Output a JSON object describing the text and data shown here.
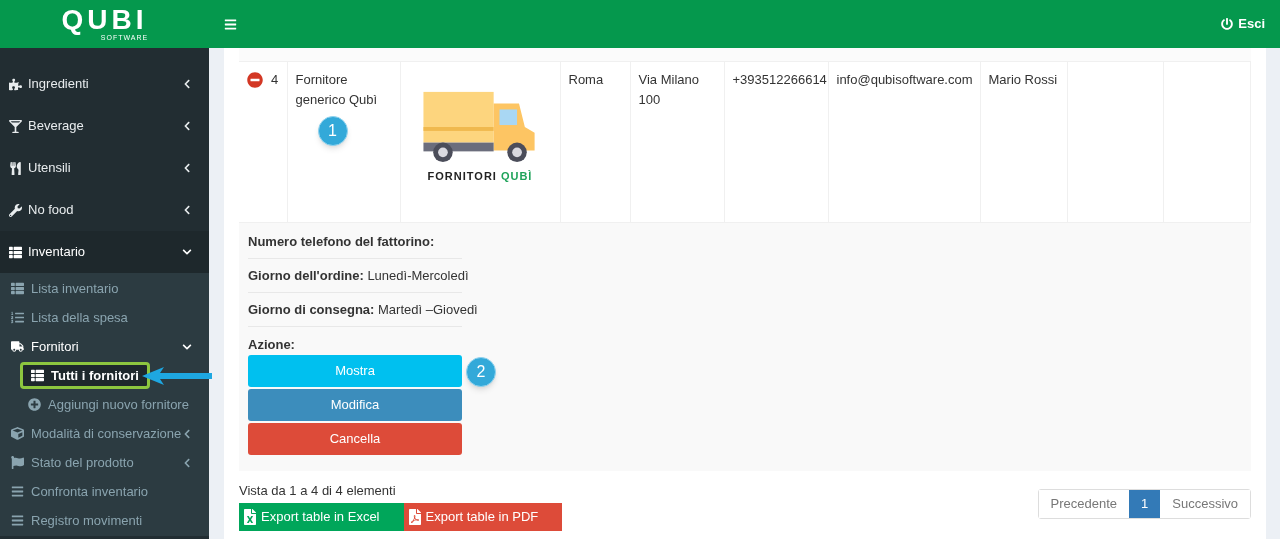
{
  "logo": {
    "name": "QUBI",
    "tagline": "SOFTWARE"
  },
  "topbar": {
    "logout": "Esci"
  },
  "sidebar": {
    "items": [
      {
        "label": "Ingredienti",
        "expanded": false,
        "selected": false
      },
      {
        "label": "Beverage",
        "expanded": false,
        "selected": false
      },
      {
        "label": "Utensili",
        "expanded": false,
        "selected": false
      },
      {
        "label": "No food",
        "expanded": false,
        "selected": false
      },
      {
        "label": "Inventario",
        "expanded": true,
        "selected": true,
        "children": [
          {
            "label": "Lista inventario",
            "selected": false
          },
          {
            "label": "Lista della spesa",
            "selected": false
          },
          {
            "label": "Fornitori",
            "expanded": true,
            "selected": true,
            "children": [
              {
                "label": "Tutti i fornitori",
                "selected": true
              },
              {
                "label": "Aggiungi nuovo fornitore",
                "selected": false
              }
            ]
          },
          {
            "label": "Modalità di conservazione",
            "expanded": false,
            "selected": false
          },
          {
            "label": "Stato del prodotto",
            "expanded": false,
            "selected": false
          },
          {
            "label": "Confronta inventario",
            "selected": false
          },
          {
            "label": "Registro movimenti",
            "selected": false
          }
        ]
      }
    ]
  },
  "table": {
    "row": {
      "expanded": true,
      "id": "4",
      "name": "Fornitore generico Qubì",
      "image_caption": [
        "FORNITORI",
        "QUBÌ"
      ],
      "city": "Roma",
      "address": "Via Milano 100",
      "phone": "+393512266614",
      "email": "info@qubisoftware.com",
      "contact": "Mario Rossi"
    },
    "details": [
      {
        "label": "Numero telefono del fattorino:"
      },
      {
        "label": "Giorno dell'ordine:",
        "value": "Lunedì-Mercoledì"
      },
      {
        "label": "Giorno di consegna:",
        "value": "Martedì –Giovedì"
      }
    ],
    "actions_label": "Azione:",
    "actions": [
      {
        "label": "Mostra",
        "kind": "show"
      },
      {
        "label": "Modifica",
        "kind": "edit"
      },
      {
        "label": "Cancella",
        "kind": "delete"
      }
    ]
  },
  "footer": {
    "info": "Vista da 1 a 4 di 4 elementi",
    "exports": [
      {
        "label": "Export table in Excel",
        "kind": "excel"
      },
      {
        "label": "Export table in PDF",
        "kind": "pdf"
      }
    ],
    "pagination": [
      {
        "label": "Precedente",
        "selected": false
      },
      {
        "label": "1",
        "selected": true
      },
      {
        "label": "Successivo",
        "selected": false
      }
    ]
  },
  "annotations": [
    "1",
    "2"
  ]
}
